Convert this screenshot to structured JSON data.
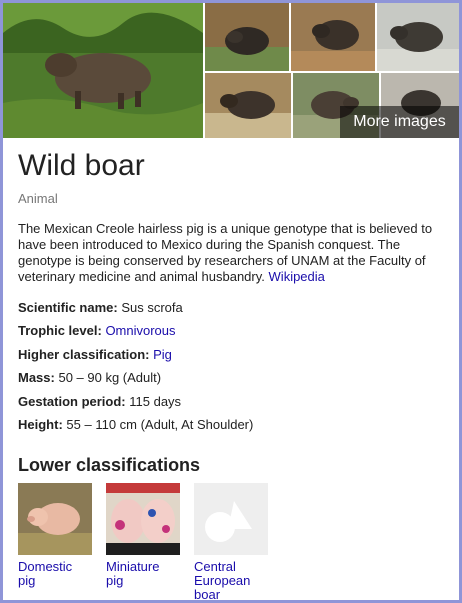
{
  "gallery": {
    "more_images_label": "More images"
  },
  "entity": {
    "title": "Wild boar",
    "type": "Animal",
    "description": "The Mexican Creole hairless pig is a unique genotype that is believed to have been introduced to Mexico during the Spanish conquest. The genotype is being conserved by researchers of UNAM at the Faculty of veterinary medicine and animal husbandry.",
    "source_link": "Wikipedia"
  },
  "facts": [
    {
      "label": "Scientific name:",
      "value": "Sus scrofa",
      "is_link": false
    },
    {
      "label": "Trophic level:",
      "value": "Omnivorous",
      "is_link": true
    },
    {
      "label": "Higher classification:",
      "value": "Pig",
      "is_link": true
    },
    {
      "label": "Mass:",
      "value": "50 – 90 kg (Adult)",
      "is_link": false
    },
    {
      "label": "Gestation period:",
      "value": "115 days",
      "is_link": false
    },
    {
      "label": "Height:",
      "value": "55 – 110 cm (Adult, At Shoulder)",
      "is_link": false
    }
  ],
  "lower_classifications": {
    "heading": "Lower classifications",
    "items": [
      {
        "label_line1": "Domestic",
        "label_line2": "pig",
        "label_line3": ""
      },
      {
        "label_line1": "Miniature",
        "label_line2": "pig",
        "label_line3": ""
      },
      {
        "label_line1": "Central",
        "label_line2": "European",
        "label_line3": "boar"
      }
    ]
  },
  "colors": {
    "link": "#1a0dab",
    "border": "#8f95d8",
    "muted": "#777777"
  }
}
